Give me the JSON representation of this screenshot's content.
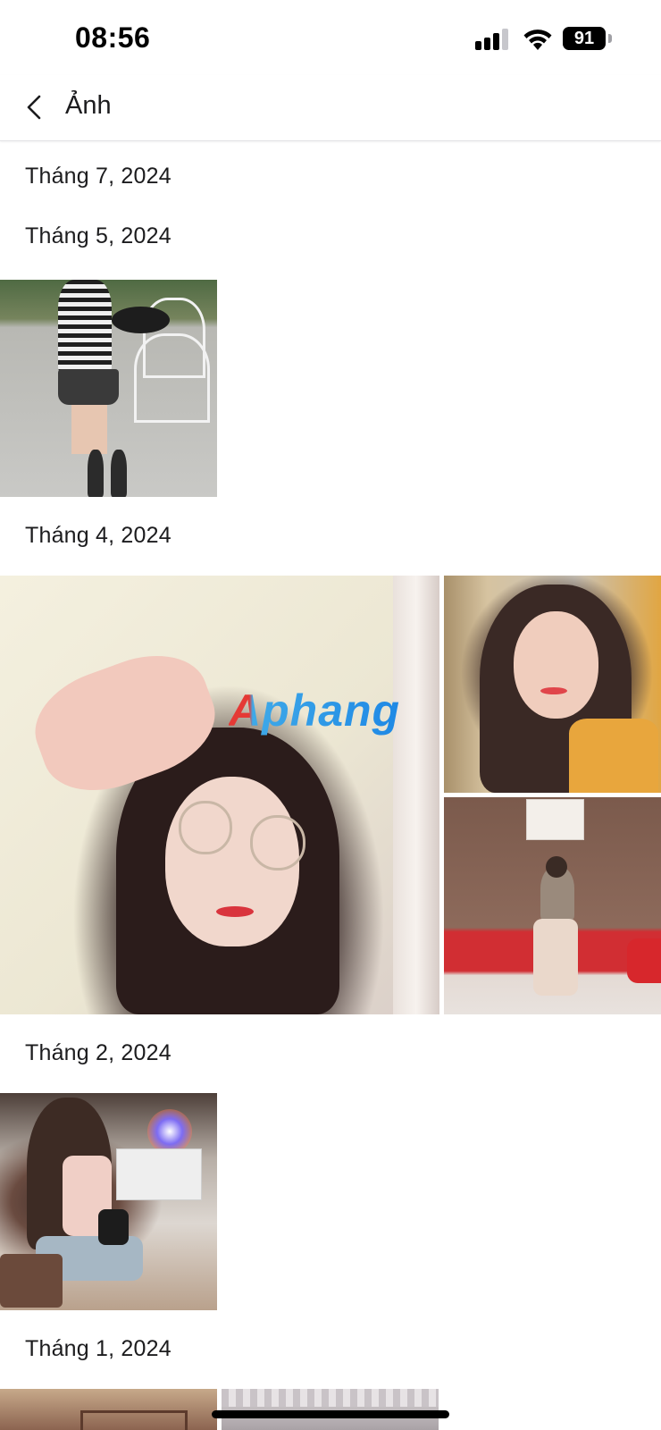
{
  "status_bar": {
    "time": "08:56",
    "battery_level": "91",
    "signal_bars_active": 3,
    "signal_bars_total": 4,
    "icons": [
      "signal-icon",
      "wifi-icon",
      "battery-icon"
    ]
  },
  "nav": {
    "back_icon": "chevron-left-icon",
    "title": "Ảnh"
  },
  "sections": [
    {
      "label": "Tháng 7, 2024",
      "photo_count": 0
    },
    {
      "label": "Tháng 5, 2024",
      "photo_count": 1
    },
    {
      "label": "Tháng 4, 2024",
      "photo_count": 3,
      "watermark": "Aphang"
    },
    {
      "label": "Tháng 2, 2024",
      "photo_count": 1
    },
    {
      "label": "Tháng 1, 2024",
      "photo_count": 2
    }
  ],
  "colors": {
    "background": "#ffffff",
    "text": "#1c1c1e",
    "divider": "#e3e3e6"
  }
}
